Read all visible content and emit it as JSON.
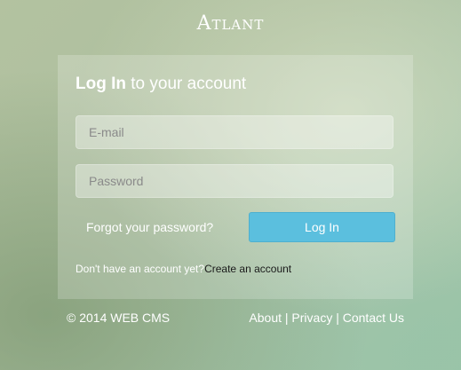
{
  "brand": {
    "logo_text": "Atlant"
  },
  "login": {
    "title_bold": "Log In",
    "title_rest": " to your account",
    "email_placeholder": "E-mail",
    "password_placeholder": "Password",
    "forgot_label": "Forgot your password?",
    "submit_label": "Log In",
    "signup_prompt": "Don't have an account yet?",
    "signup_link": "Create an account"
  },
  "footer": {
    "copyright": "© 2014 WEB CMS",
    "links": [
      "About",
      "Privacy",
      "Contact Us"
    ],
    "separator": "|"
  },
  "colors": {
    "button": "#5bbfde",
    "text": "#ffffff"
  }
}
